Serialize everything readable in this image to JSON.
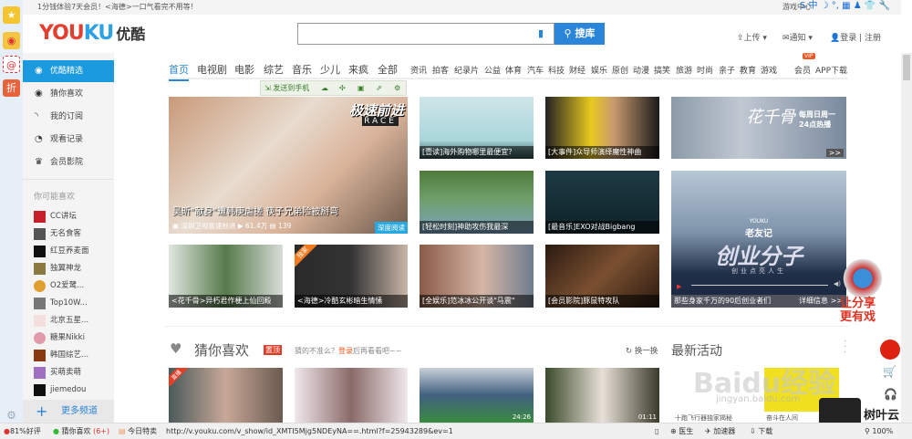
{
  "topbar": {
    "promo": "1分钱体验7天会员！<海德>一口气看完不用等！",
    "game_center": "游戏中心",
    "ime": "S 中 ☽ °, ▦ ♟ 👕 🔧"
  },
  "header": {
    "logo_en_a": "YOU",
    "logo_en_b": "KU",
    "logo_cn": "优酷",
    "search_placeholder": "",
    "search_button": "搜库",
    "upload": "上传",
    "notify": "通知",
    "login": "登录",
    "register": "注册"
  },
  "sidebar": {
    "items": [
      {
        "label": "优酷精选",
        "icon": "play-circle-icon"
      },
      {
        "label": "猜你喜欢",
        "icon": "eye-icon"
      },
      {
        "label": "我的订阅",
        "icon": "rss-icon"
      },
      {
        "label": "观看记录",
        "icon": "clock-icon"
      },
      {
        "label": "会员影院",
        "icon": "crown-icon"
      }
    ],
    "maybe_like": "你可能喜欢",
    "channels": [
      "CC讲坛",
      "无名食客",
      "红豆养麦面",
      "独翼神龙",
      "O2爱鹭...",
      "Top10W...",
      "北京五星...",
      "糖果Nikki",
      "韩国综艺...",
      "买萌卖萌",
      "jiemedou"
    ],
    "more": "更多频道"
  },
  "nav": {
    "main": [
      "首页",
      "电视剧",
      "电影",
      "综艺",
      "音乐",
      "少儿",
      "来疯",
      "全部"
    ],
    "sub": [
      "资讯",
      "拍客",
      "纪录片",
      "公益",
      "体育",
      "汽车",
      "科技",
      "财经",
      "娱乐",
      "原创",
      "动漫",
      "搞笑",
      "旅游",
      "时尚",
      "亲子",
      "教育",
      "游戏"
    ],
    "vip_badge": "VIP",
    "member": "会员",
    "app": "APP下载"
  },
  "sharebar": {
    "send": "发送到手机"
  },
  "feature": {
    "logo": "极速前进",
    "logo_en": "RACE",
    "title": "吴昕\"献身\"遭韩庚虐搓 筷子兄弟险被掰弯",
    "channel": "深圳卫视极速前进",
    "plays": "61.4万",
    "comments": "139",
    "badge": "深度阅读"
  },
  "cards": [
    "[壹读]海外购物哪里最便宜？",
    "[大事件]众导师演绎魔性神曲",
    "[轻松时刻]神助攻伤我最深",
    "[最音乐]EXO对战Bigbang",
    "<花千骨>异朽君作梗上仙回殿",
    "<海德>冷酷玄彬暗生情愫",
    "[全娱乐]范冰冰公开谈\"马震\"",
    "[会员影院]豚鼠特攻队"
  ],
  "banner1": {
    "title": "花千骨",
    "schedule_a": "每周日周一",
    "schedule_b": "24点热播",
    "more": ">>"
  },
  "banner2": {
    "brand": "YOUKU",
    "sub": "老友记",
    "title": "创业分子",
    "tagline": "创业点亮人生",
    "caption": "那些身家千万的90后创业者们",
    "detail": "详细信息 >>"
  },
  "exclusive": "独家",
  "share_ad": {
    "line1": "让分享",
    "line2": "更有戏"
  },
  "guess": {
    "title": "猜你喜欢",
    "badge": "置顶",
    "hint_a": "猜的不准么？",
    "hint_login": "登录",
    "hint_b": "后再看看吧~~",
    "refresh": "换一换",
    "latest": "最新活动"
  },
  "bottom": {
    "durations": [
      "",
      "",
      "24:26",
      "01:11"
    ],
    "captions": [
      "十跑飞行器独家揭秘",
      "奋斗在人间"
    ],
    "first_badge": "直播"
  },
  "watermark": {
    "text": "Baidu经验",
    "sub": "jingyan.baidu.com",
    "brand": "树叶云"
  },
  "status": {
    "rating": "81%好评",
    "guess": "猜你喜欢",
    "guess_count": "(6+)",
    "deals": "今日特卖",
    "url": "http://v.youku.com/v_show/id_XMTI5Mjg5NDEyNA==.html?f=25943289&ev=1",
    "doctor": "医生",
    "accel": "加速器",
    "download": "下载",
    "zoom": "100%"
  }
}
